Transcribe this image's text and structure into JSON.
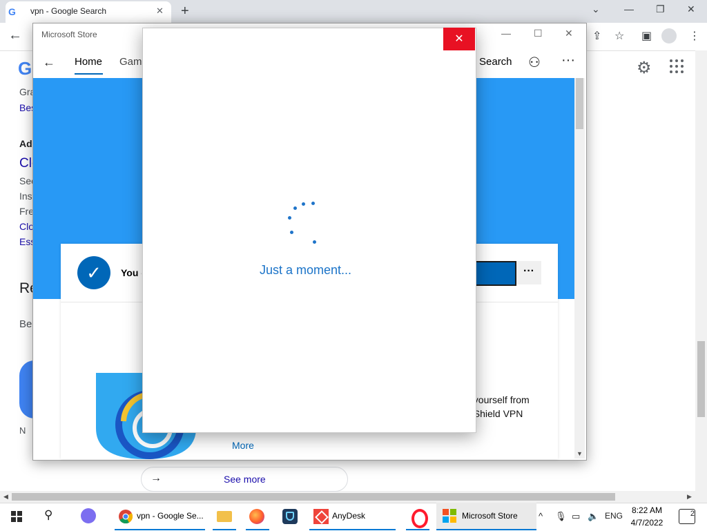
{
  "browser": {
    "tab_title": "vpn - Google Search",
    "tab_favicon": "G",
    "google_logo_letter": "G",
    "left_fragments": [
      "Gra",
      "Bes",
      "Ad",
      "Clo",
      "Sec",
      "Inst",
      "Free",
      "Clo",
      "Ess",
      "Re",
      "Be",
      "N"
    ],
    "see_more_label": "See more"
  },
  "store": {
    "window_title": "Microsoft Store",
    "nav": {
      "home": "Home",
      "gaming": "Gami",
      "search": "Search"
    },
    "owned_text": "You o",
    "card_description_line1": "t yourself from",
    "card_description_line2": "t Shield VPN",
    "more_link": "More",
    "accent_color": "#0067b8",
    "hero_color": "#2899f5"
  },
  "dialog": {
    "loading_text": "Just a moment..."
  },
  "taskbar": {
    "apps": [
      {
        "label": "vpn - Google Se...",
        "icon": "chrome-icon"
      },
      {
        "label": "",
        "icon": "file-explorer-icon"
      },
      {
        "label": "",
        "icon": "firefox-icon"
      },
      {
        "label": "",
        "icon": "shield-app-icon"
      },
      {
        "label": "AnyDesk",
        "icon": "anydesk-icon"
      },
      {
        "label": "",
        "icon": "opera-icon"
      },
      {
        "label": "Microsoft Store",
        "icon": "microsoft-store-icon"
      }
    ],
    "language": "ENG",
    "time": "8:22 AM",
    "date": "4/7/2022",
    "notification_count": "2"
  }
}
